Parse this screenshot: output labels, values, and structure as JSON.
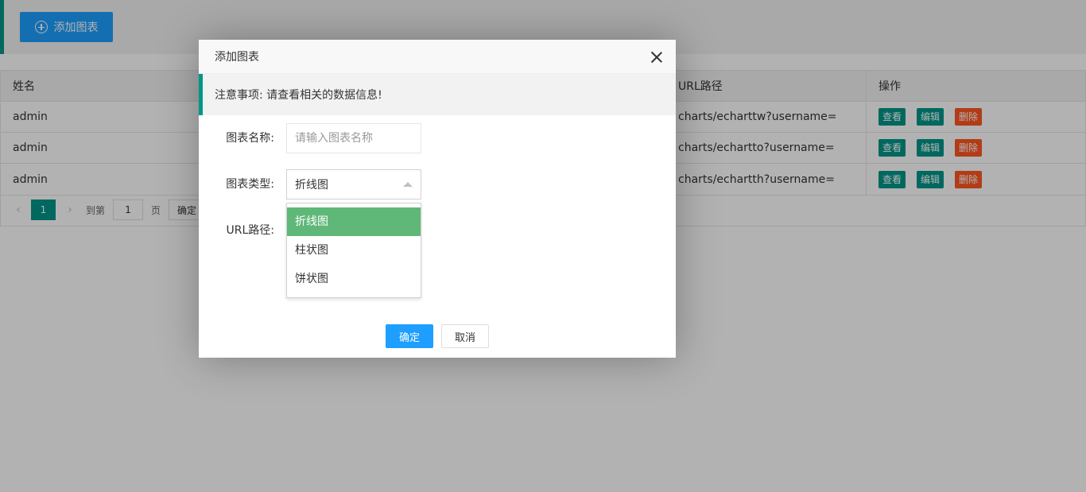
{
  "toolbar": {
    "add_label": "添加图表"
  },
  "table": {
    "headers": {
      "name": "姓名",
      "url": "URL路径",
      "ops": "操作"
    },
    "rows": [
      {
        "name": "admin",
        "url": "charts/echarttw?username="
      },
      {
        "name": "admin",
        "url": "charts/echartto?username="
      },
      {
        "name": "admin",
        "url": "charts/echartth?username="
      }
    ],
    "ops": {
      "view": "查看",
      "edit": "编辑",
      "delete": "删除"
    }
  },
  "pager": {
    "current": "1",
    "goto_prefix": "到第",
    "goto_value": "1",
    "goto_suffix": "页",
    "confirm": "确定"
  },
  "dialog": {
    "title": "添加图表",
    "notice": "注意事项: 请查看相关的数据信息!",
    "fields": {
      "name_label": "图表名称:",
      "name_placeholder": "请输入图表名称",
      "type_label": "图表类型:",
      "type_value": "折线图",
      "url_label": "URL路径:"
    },
    "options": [
      "折线图",
      "柱状图",
      "饼状图"
    ],
    "ok": "确定",
    "cancel": "取消"
  },
  "colors": {
    "primary": "#1E9FFF",
    "teal": "#009688",
    "danger": "#FF5722",
    "selected": "#5FB878"
  }
}
